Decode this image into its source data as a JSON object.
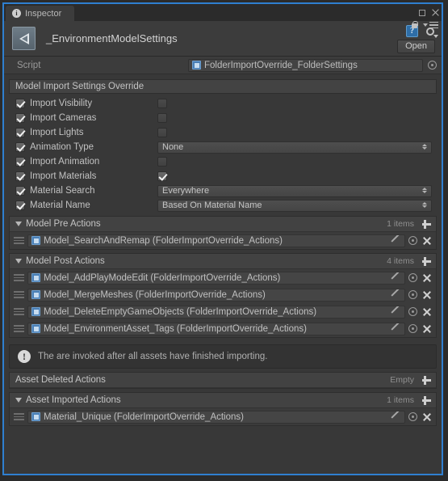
{
  "window": {
    "tab_label": "Inspector",
    "tab_icon": "info-icon",
    "maximize_icon": "maximize-icon",
    "close_icon": "close-icon",
    "lock_icon": "lock-icon",
    "menu_icon": "hamburger-menu-icon",
    "accent_color": "#2f7fd0",
    "background_color": "#383838"
  },
  "header": {
    "object_icon": "unity-logo-icon",
    "title": "_EnvironmentModelSettings",
    "help_icon": "help-question-icon",
    "help_glyph": "?",
    "gear_icon": "gear-icon",
    "open_button": "Open"
  },
  "script_row": {
    "label": "Script",
    "value": "FolderImportOverride_FolderSettings",
    "value_icon": "script-asset-icon",
    "picker_icon": "object-picker-icon"
  },
  "section": {
    "title": "Model Import Settings Override"
  },
  "properties": [
    {
      "label": "Import Visibility",
      "override": true,
      "control": "checkbox",
      "checked": false
    },
    {
      "label": "Import Cameras",
      "override": true,
      "control": "checkbox",
      "checked": false
    },
    {
      "label": "Import Lights",
      "override": true,
      "control": "checkbox",
      "checked": false
    },
    {
      "label": "Animation Type",
      "override": true,
      "control": "dropdown",
      "value": "None"
    },
    {
      "label": "Import Animation",
      "override": true,
      "control": "checkbox",
      "checked": false
    },
    {
      "label": "Import Materials",
      "override": true,
      "control": "checkbox",
      "checked": true
    },
    {
      "label": "Material Search",
      "override": true,
      "control": "dropdown",
      "value": "Everywhere"
    },
    {
      "label": "Material Name",
      "override": true,
      "control": "dropdown",
      "value": "Based On Material Name"
    }
  ],
  "lists": [
    {
      "title": "Model Pre Actions",
      "expanded": true,
      "count_label": "1 items",
      "add_icon": "plus-icon",
      "rows": [
        {
          "text": "Model_SearchAndRemap (FolderImportOverride_Actions)"
        }
      ]
    },
    {
      "title": "Model Post Actions",
      "expanded": true,
      "count_label": "4 items",
      "add_icon": "plus-icon",
      "rows": [
        {
          "text": "Model_AddPlayModeEdit (FolderImportOverride_Actions)"
        },
        {
          "text": "Model_MergeMeshes (FolderImportOverride_Actions)"
        },
        {
          "text": "Model_DeleteEmptyGameObjects (FolderImportOverride_Actions)"
        },
        {
          "text": "Model_EnvironmentAsset_Tags (FolderImportOverride_Actions)"
        }
      ]
    }
  ],
  "helpbox": {
    "icon": "info-exclamation-icon",
    "glyph": "!",
    "text": "The are invoked after all assets have finished importing."
  },
  "lists2": [
    {
      "title": "Asset Deleted Actions",
      "expanded": false,
      "count_label": "Empty",
      "add_icon": "plus-icon",
      "rows": []
    },
    {
      "title": "Asset Imported Actions",
      "expanded": true,
      "count_label": "1 items",
      "add_icon": "plus-icon",
      "rows": [
        {
          "text": "Material_Unique (FolderImportOverride_Actions)"
        }
      ]
    }
  ],
  "row_icons": {
    "drag_handle": "drag-handle-icon",
    "asset_icon": "script-asset-icon",
    "edit_icon": "pencil-edit-icon",
    "picker_icon": "object-picker-icon",
    "remove_icon": "remove-x-icon"
  }
}
